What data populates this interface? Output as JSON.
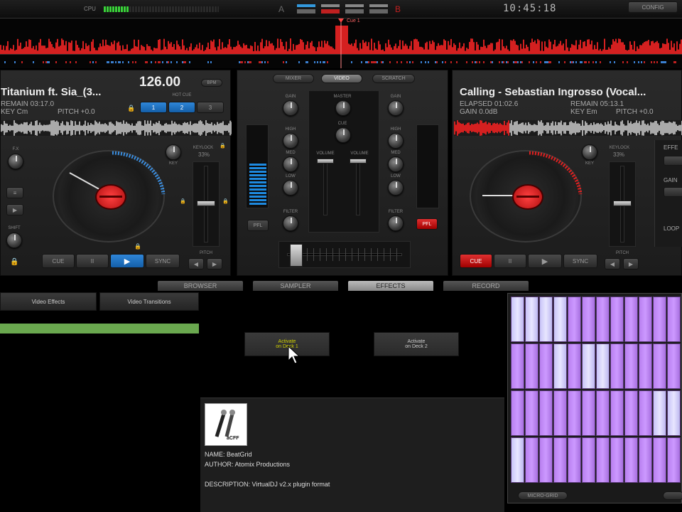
{
  "topbar": {
    "cpu_label": "CPU",
    "a_label": "A",
    "b_label": "B",
    "clock": "10:45:18",
    "config_label": "CONFIG"
  },
  "waveform": {
    "cue_label": "Cue 1"
  },
  "left_deck": {
    "title": "Titanium ft. Sia_(3...",
    "bpm": "126.00",
    "bpm_button": "BPM",
    "remain": "REMAIN 03:17.0",
    "key": "KEY Cm",
    "pitch": "PITCH +0.0",
    "hot_cue_label": "HOT CUE",
    "hot_cues": [
      "1",
      "2",
      "3"
    ],
    "keylock_label": "KEYLOCK",
    "keylock_value": "33%",
    "key_knob_label": "KEY",
    "fx_label": "F.X",
    "shift_label": "SHIFT",
    "pitch_label": "PITCH",
    "transport": {
      "cue": "CUE",
      "pause": "II",
      "play": "▶",
      "sync": "SYNC"
    }
  },
  "right_deck": {
    "title": "Calling - Sebastian Ingrosso (Vocal...",
    "elapsed": "ELAPSED 01:02.6",
    "remain": "REMAIN 05:13.1",
    "gain": "GAIN 0.0dB",
    "key": "KEY Em",
    "pitch": "PITCH +0.0",
    "keylock_label": "KEYLOCK",
    "keylock_value": "33%",
    "key_knob_label": "KEY",
    "effect_label": "EFFE",
    "gain_label": "GAIN",
    "loop_label": "LOOP",
    "pitch_label": "PITCH",
    "transport": {
      "cue": "CUE",
      "pause": "II",
      "play": "▶",
      "sync": "SYNC"
    }
  },
  "mixer": {
    "tabs": [
      "MIXER",
      "VIDEO",
      "SCRATCH"
    ],
    "gain": "GAIN",
    "master": "MASTER",
    "cue": "CUE",
    "high": "HIGH",
    "mid": "MED",
    "low": "LOW",
    "volume": "VOLUME",
    "filter": "FILTER",
    "pfl": "PFL"
  },
  "bottom_tabs": [
    "BROWSER",
    "SAMPLER",
    "EFFECTS",
    "RECORD"
  ],
  "effects": {
    "list_tabs": [
      "Video Effects",
      "Video Transitions"
    ],
    "activate_deck1": [
      "Activate",
      "on Deck 1"
    ],
    "activate_deck2": [
      "Activate",
      "on Deck 2"
    ],
    "logo_text": "aCFF",
    "name": "NAME: BeatGrid",
    "author": "AUTHOR: Atomix Productions",
    "description": "DESCRIPTION: VirtualDJ v2.x plugin format"
  },
  "grid": {
    "bottom_label": "MICRO-GRID",
    "colors": {
      "cell": "#cc99ff",
      "cell_on": "#e8e6ff",
      "border": "#5a3a78"
    }
  },
  "colors": {
    "accent_red": "#e02020",
    "accent_blue": "#2f86d8",
    "waveform_red": "#d42020"
  }
}
